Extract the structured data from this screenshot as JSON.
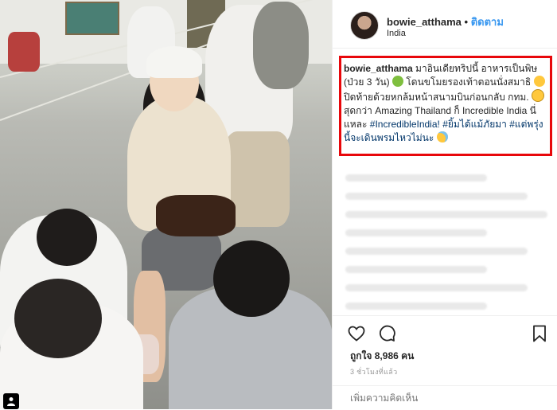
{
  "post": {
    "username": "bowie_atthama",
    "dot": "•",
    "follow_label": "ติดตาม",
    "location": "India",
    "caption": {
      "user": "bowie_atthama",
      "line1": "มาอินเดียทริปนี้ อาหารเป็นพิษ (ป่วย 3 วัน)",
      "line2": "โดนขโมยรองเท้าตอนนั่งสมาธิ",
      "line3": "ปิดท้ายด้วยหกล้มหน้าสนามบินก่อนกลับ กทม.",
      "line4": "สุดกว่า Amazing Thailand ก็ Incredible India นี่แหละ",
      "tag1": "#IncredibleIndia!",
      "tag2": "#ยิ้มได้แม้ภัยมา",
      "tag3": "#แต่พรุ่งนี้จะเดินพรมไหวไม่นะ"
    },
    "likes_label": "ถูกใจ 8,986 คน",
    "time_label": "3 ชั่วโมงที่แล้ว",
    "add_comment_placeholder": "เพิ่มความคิดเห็น"
  },
  "icons": {
    "heart": "heart-icon",
    "comment": "comment-icon",
    "bookmark": "bookmark-icon",
    "photo_user": "user-tag-icon"
  },
  "colors": {
    "follow": "#3897f0",
    "highlight_border": "#e8070b",
    "hashtag": "#003569"
  }
}
